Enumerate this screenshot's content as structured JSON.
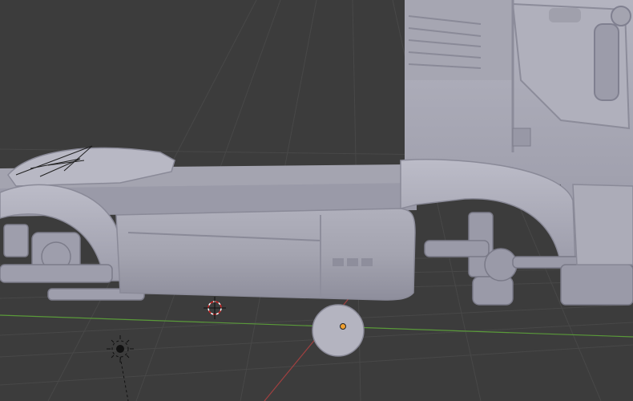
{
  "viewport": {
    "background": "#3c3c3c",
    "grid_color": "#4a4a4a",
    "x_axis_color": "#5a9a3a",
    "y_axis_color": "#a04040",
    "model_color": "#a8a8b4"
  },
  "objects": [
    {
      "name": "truck-model",
      "icon": "mesh-object",
      "selected": false
    },
    {
      "name": "wheel-cylinder",
      "icon": "cylinder-object",
      "selected": true
    },
    {
      "name": "lamp",
      "icon": "light-icon"
    },
    {
      "name": "3d-cursor",
      "icon": "cursor-icon"
    }
  ]
}
